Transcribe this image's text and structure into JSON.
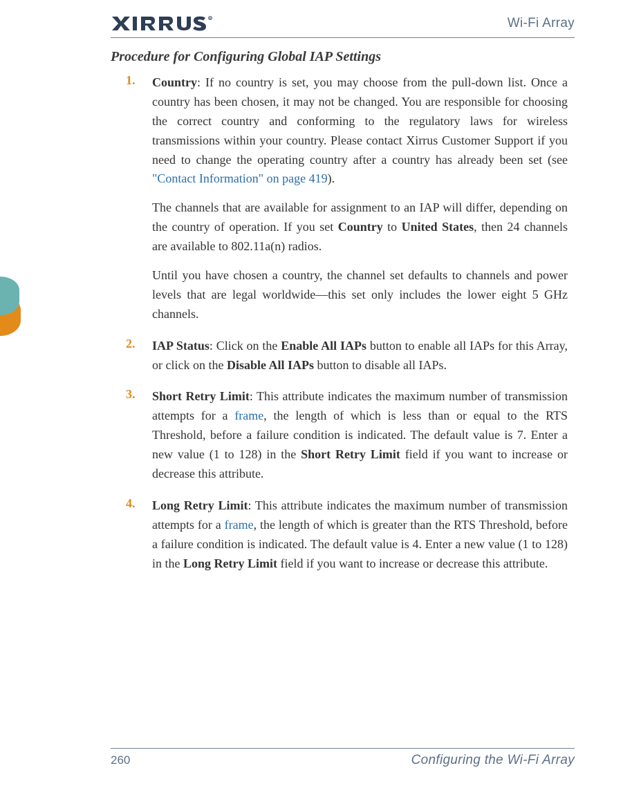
{
  "header": {
    "product": "Wi-Fi Array"
  },
  "section_title": "Procedure for Configuring Global IAP Settings",
  "items": [
    {
      "num": "1.",
      "title": "Country",
      "para1_a": ": If no country is set, you may choose from the pull-down list. Once a country has been chosen, it may not be changed. You are responsible for choosing the correct country and conforming to the regulatory laws for wireless transmissions within your country. Please contact Xirrus Customer Support if you need to change the operating country after a country has already been set (see ",
      "para1_link": "\"Contact Information\" on page 419",
      "para1_b": ").",
      "para2_a": "The channels that are available for assignment to an IAP will differ, depending on the country of operation. If you set ",
      "para2_b1": "Country",
      "para2_c": " to ",
      "para2_b2": "United States",
      "para2_d": ", then 24 channels are available to 802.11a(n) radios.",
      "para3": "Until you have chosen a country, the channel set defaults to channels and power levels that are legal worldwide—this set only includes the lower eight 5 GHz channels."
    },
    {
      "num": "2.",
      "title": "IAP Status",
      "para1_a": ": Click on the ",
      "para1_b1": "Enable All IAPs",
      "para1_c": " button to enable all IAPs for this Array, or click on the ",
      "para1_b2": "Disable All IAPs",
      "para1_d": " button to disable all IAPs."
    },
    {
      "num": "3.",
      "title": "Short Retry Limit",
      "para1_a": ": This attribute indicates the maximum number of transmission attempts for a ",
      "para1_link": "frame",
      "para1_b": ", the length of which is less than or equal to the RTS Threshold, before a failure condition is indicated. The default value is 7. Enter a new value (1 to 128) in the ",
      "para1_b1": "Short Retry Limit",
      "para1_c": " field if you want to increase or decrease this attribute."
    },
    {
      "num": "4.",
      "title": "Long Retry Limit",
      "para1_a": ": This attribute indicates the maximum number of transmission attempts for a ",
      "para1_link": "frame",
      "para1_b": ", the length of which is greater than the RTS Threshold, before a failure condition is indicated. The default value is 4. Enter a new value (1 to 128) in the ",
      "para1_b1": "Long Retry Limit",
      "para1_c": " field if you want to increase or decrease this attribute."
    }
  ],
  "footer": {
    "page": "260",
    "section": "Configuring the Wi-Fi Array"
  }
}
